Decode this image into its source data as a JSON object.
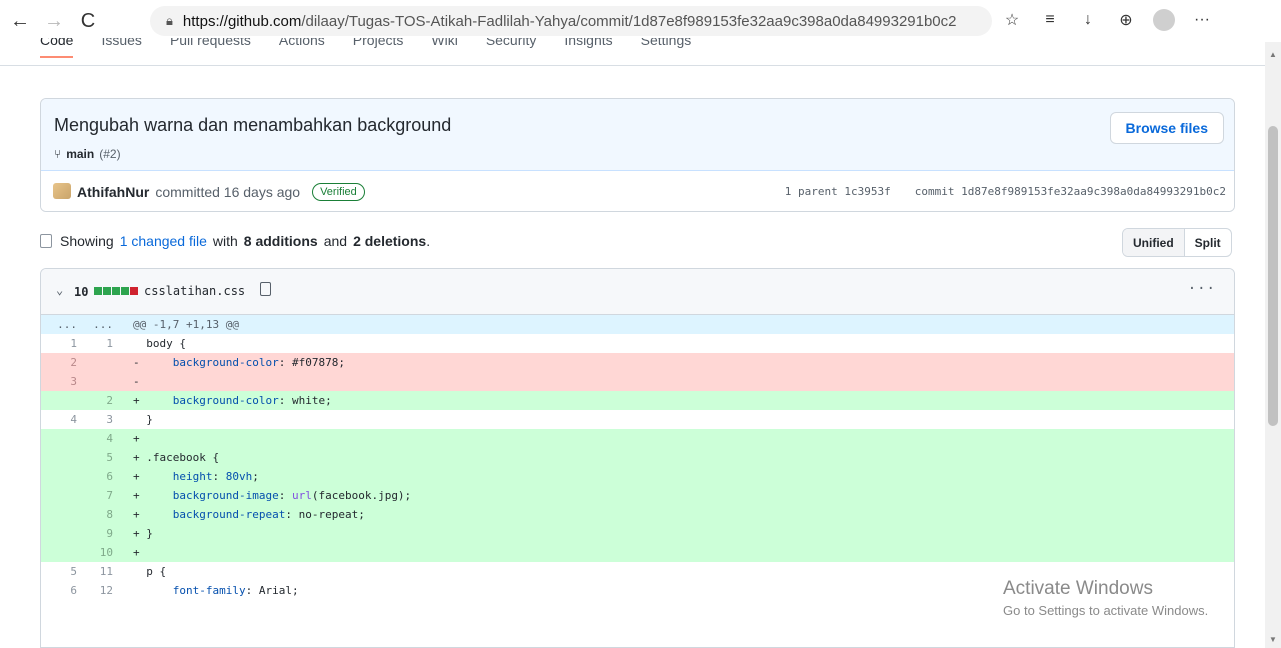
{
  "browser": {
    "back": "←",
    "forward": "→",
    "reload": "C",
    "url_host": "https://github.com",
    "url_path": "/dilaay/Tugas-TOS-Atikah-Fadlilah-Yahya/commit/1d87e8f989153fe32aa9c398a0da84993291b0c2",
    "more": "···"
  },
  "repo_nav": [
    "Code",
    "Issues",
    "Pull requests",
    "Actions",
    "Projects",
    "Wiki",
    "Security",
    "Insights",
    "Settings"
  ],
  "commit": {
    "title": "Mengubah warna dan menambahkan background",
    "branch": "main",
    "pr": "(#2)",
    "browse_files": "Browse files",
    "author": "AthifahNur",
    "committed": "committed 16 days ago",
    "verified": "Verified",
    "parent": "1 parent 1c3953f",
    "commit_sha": "commit 1d87e8f989153fe32aa9c398a0da84993291b0c2"
  },
  "summary": {
    "showing": "Showing",
    "changed": "1 changed file",
    "with": "with",
    "additions": "8 additions",
    "and": "and",
    "deletions": "2 deletions",
    "period": ".",
    "unified": "Unified",
    "split": "Split"
  },
  "file": {
    "count": "10",
    "name": "csslatihan.css",
    "menu": "···"
  },
  "diff": [
    {
      "type": "hunk",
      "old": "...",
      "new": "...",
      "code": "@@ -1,7 +1,13 @@"
    },
    {
      "type": "ctx",
      "old": "1",
      "new": "1",
      "code": "  body {"
    },
    {
      "type": "del",
      "old": "2",
      "new": "",
      "code": "-     background-color: #f07878;"
    },
    {
      "type": "del",
      "old": "3",
      "new": "",
      "code": "-"
    },
    {
      "type": "add",
      "old": "",
      "new": "2",
      "code": "+     background-color: white;"
    },
    {
      "type": "ctx",
      "old": "4",
      "new": "3",
      "code": "  }"
    },
    {
      "type": "add",
      "old": "",
      "new": "4",
      "code": "+"
    },
    {
      "type": "add",
      "old": "",
      "new": "5",
      "code": "+ .facebook {"
    },
    {
      "type": "add",
      "old": "",
      "new": "6",
      "code": "+     height: 80vh;"
    },
    {
      "type": "add",
      "old": "",
      "new": "7",
      "code": "+     background-image: url(facebook.jpg);"
    },
    {
      "type": "add",
      "old": "",
      "new": "8",
      "code": "+     background-repeat: no-repeat;"
    },
    {
      "type": "add",
      "old": "",
      "new": "9",
      "code": "+ }"
    },
    {
      "type": "add",
      "old": "",
      "new": "10",
      "code": "+"
    },
    {
      "type": "ctx",
      "old": "5",
      "new": "11",
      "code": "  p {"
    },
    {
      "type": "ctx",
      "old": "6",
      "new": "12",
      "code": "      font-family: Arial;"
    }
  ],
  "watermark": {
    "line1": "Activate Windows",
    "line2": "Go to Settings to activate Windows."
  },
  "colors": {
    "link": "#0969da",
    "add_bg": "#ccffd8",
    "del_bg": "#ffd7d5",
    "hunk_bg": "#ddf4ff",
    "header_bg": "#f1f8ff"
  }
}
